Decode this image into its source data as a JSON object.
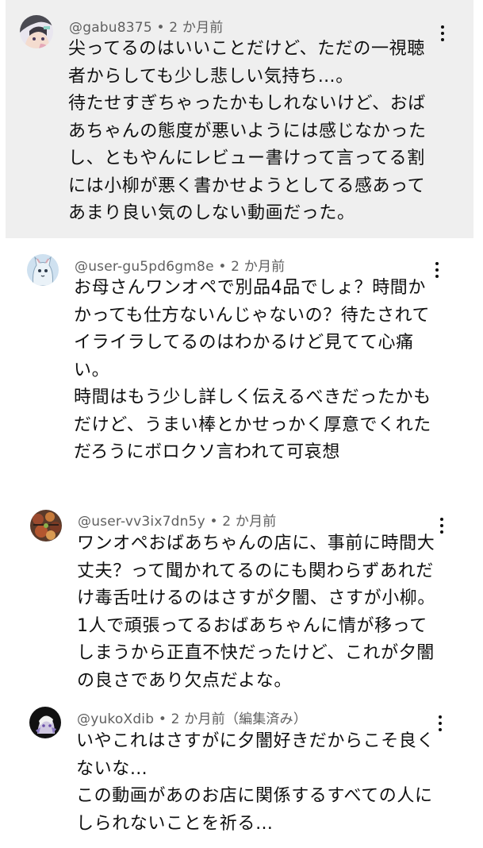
{
  "comments": [
    {
      "meta": "@gabu8375 • 2 か月前",
      "text": "尖ってるのはいいことだけど、ただの一視聴\n者からしても少し悲しい気持ち…。\n待たせすぎちゃったかもしれないけど、おば\nあちゃんの態度が悪いようには感じなかった\nし、ともやんにレビュー書けって言ってる割\nには小柳が悪く書かせようとしてる感あって\nあまり良い気のしない動画だった。",
      "avatar_icon": "anime-girl-avatar"
    },
    {
      "meta": "@user-gu5pd6gm8e • 2 か月前",
      "text": "お母さんワンオペで別品4品でしょ？時間か\nかっても仕方ないんじゃないの？待たされて\nイライラしてるのはわかるけど見てて心痛\nい。\n時間はもう少し詳しく伝えるべきだったかも\nだけど、うまい棒とかせっかく厚意でくれた\nだろうにボロクソ言われて可哀想",
      "avatar_icon": "cat-avatar"
    },
    {
      "meta": "@user-vv3ix7dn5y • 2 か月前",
      "text": "ワンオペおばあちゃんの店に、事前に時間大\n丈夫？って聞かれてるのにも関わらずあれだ\nけ毒舌吐けるのはさすが夕闇、さすが小柳。\n1人で頑張ってるおばあちゃんに情が移って\nしまうから正直不快だったけど、これが夕闇\nの良さであり欠点だよな。",
      "avatar_icon": "food-avatar"
    },
    {
      "meta": "@yukoXdib • 2 か月前（編集済み）",
      "text": "いやこれはさすがに夕闇好きだからこそ良く\nないな…\nこの動画があのお店に関係するすべての人に\nしられないことを祈る…",
      "avatar_icon": "character-avatar"
    }
  ],
  "colors": {
    "highlight_bg": "#efefef",
    "meta_text": "#606060",
    "body_text": "#0f0f0f"
  }
}
